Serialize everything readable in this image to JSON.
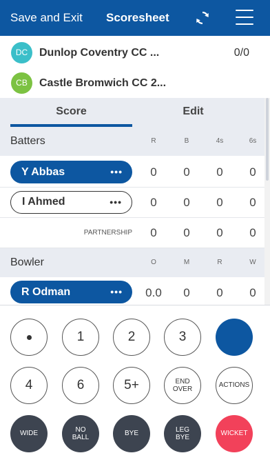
{
  "topbar": {
    "exit_label": "Save and Exit",
    "title": "Scoresheet",
    "sync_icon": "sync-icon",
    "menu_icon": "hamburger-menu-icon"
  },
  "teams": [
    {
      "initials": "DC",
      "name": "Dunlop Coventry CC ...",
      "score": "0/0",
      "color": "#3bbfc9"
    },
    {
      "initials": "CB",
      "name": "Castle Bromwich CC 2...",
      "score": "",
      "color": "#7cc242"
    }
  ],
  "tabs": {
    "score": "Score",
    "edit": "Edit"
  },
  "batters": {
    "header": "Batters",
    "columns": [
      "R",
      "B",
      "4s",
      "6s"
    ],
    "rows": [
      {
        "name": "Y Abbas",
        "more": "•••",
        "values": [
          "0",
          "0",
          "0",
          "0"
        ],
        "active": true
      },
      {
        "name": "I Ahmed",
        "more": "•••",
        "values": [
          "0",
          "0",
          "0",
          "0"
        ],
        "active": false
      }
    ],
    "partnership": {
      "label": "PARTNERSHIP",
      "values": [
        "0",
        "0",
        "0",
        "0"
      ]
    }
  },
  "bowler": {
    "header": "Bowler",
    "columns": [
      "O",
      "M",
      "R",
      "W"
    ],
    "rows": [
      {
        "name": "R Odman",
        "more": "•••",
        "values": [
          "0.0",
          "0",
          "0",
          "0"
        ]
      }
    ]
  },
  "keypad": {
    "row1": [
      "•",
      "1",
      "2",
      "3",
      ""
    ],
    "row2": [
      "4",
      "6",
      "5+",
      "END OVER",
      "ACTIONS"
    ],
    "row3": [
      "WIDE",
      "NO BALL",
      "BYE",
      "LEG BYE",
      "WICKET"
    ]
  },
  "colors": {
    "brand": "#0d57a1",
    "wicket": "#f2415a",
    "extras": "#3d4450"
  }
}
